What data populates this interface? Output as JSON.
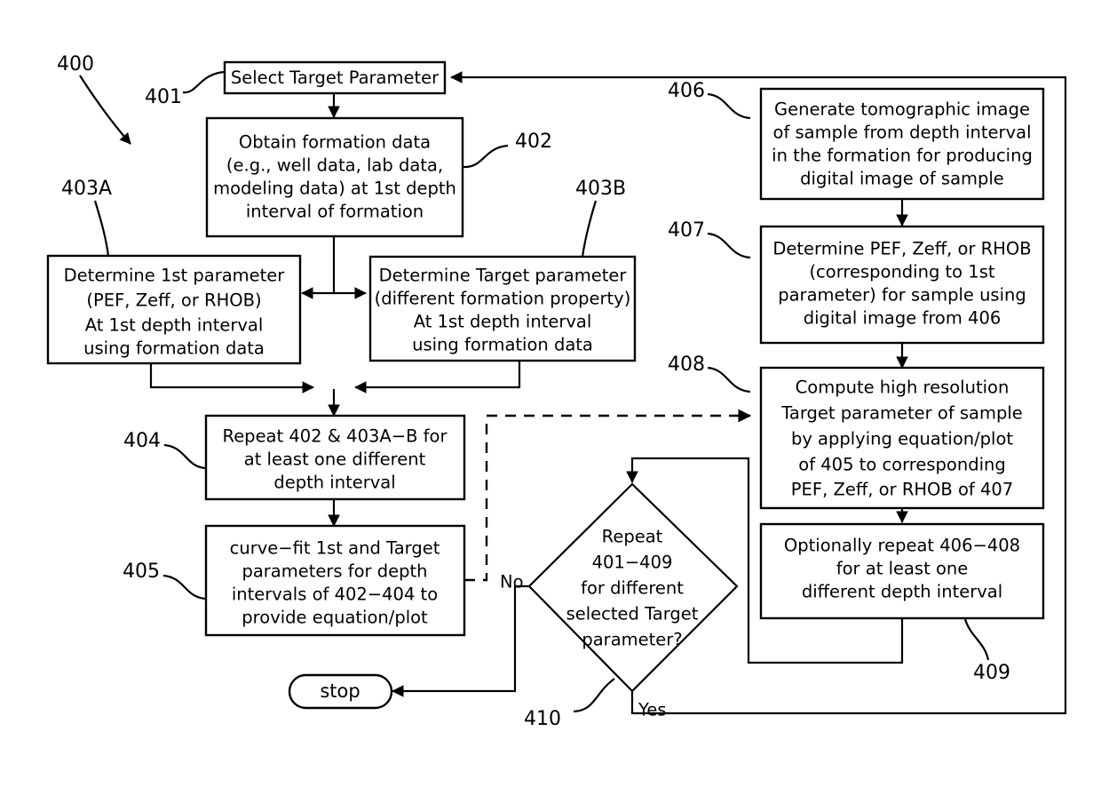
{
  "figure": {
    "number": "400",
    "type": "process-flowchart"
  },
  "nodes": {
    "n401": {
      "ref": "401",
      "lines": [
        "Select Target Parameter"
      ]
    },
    "n402": {
      "ref": "402",
      "lines": [
        "Obtain formation data",
        "(e.g., well data, lab data,",
        "modeling data) at 1st depth",
        "interval of formation"
      ]
    },
    "n403a": {
      "ref": "403A",
      "lines": [
        "Determine 1st parameter",
        "(PEF, Zeff, or RHOB)",
        "At 1st depth interval",
        "using formation data"
      ]
    },
    "n403b": {
      "ref": "403B",
      "lines": [
        "Determine Target parameter",
        "(different formation property)",
        "At 1st depth interval",
        "using formation data"
      ]
    },
    "n404": {
      "ref": "404",
      "lines": [
        "Repeat 402 & 403A−B for",
        "at least one different",
        "depth interval"
      ]
    },
    "n405": {
      "ref": "405",
      "lines": [
        "curve−fit 1st and Target",
        "parameters for depth",
        "intervals of 402−404 to",
        "provide equation/plot"
      ]
    },
    "n406": {
      "ref": "406",
      "lines": [
        "Generate tomographic image",
        "of sample from depth interval",
        "in the formation for producing",
        "digital image of sample"
      ]
    },
    "n407": {
      "ref": "407",
      "lines": [
        "Determine PEF, Zeff, or RHOB",
        "(corresponding to 1st",
        "parameter) for sample using",
        "digital image from 406"
      ]
    },
    "n408": {
      "ref": "408",
      "lines": [
        "Compute high resolution",
        "Target parameter of sample",
        "by applying equation/plot",
        "of 405 to corresponding",
        "PEF, Zeff, or RHOB of 407"
      ]
    },
    "n409": {
      "ref": "409",
      "lines": [
        "Optionally repeat 406−408",
        "for at least one",
        "different depth interval"
      ]
    },
    "n410": {
      "ref": "410",
      "lines": [
        "Repeat",
        "401−409",
        "for different",
        "selected Target",
        "parameter?"
      ]
    },
    "stop": {
      "label": "stop"
    }
  },
  "edge_labels": {
    "no": "No",
    "yes": "Yes"
  },
  "colors": {
    "stroke": "#000000",
    "fill": "#ffffff"
  }
}
